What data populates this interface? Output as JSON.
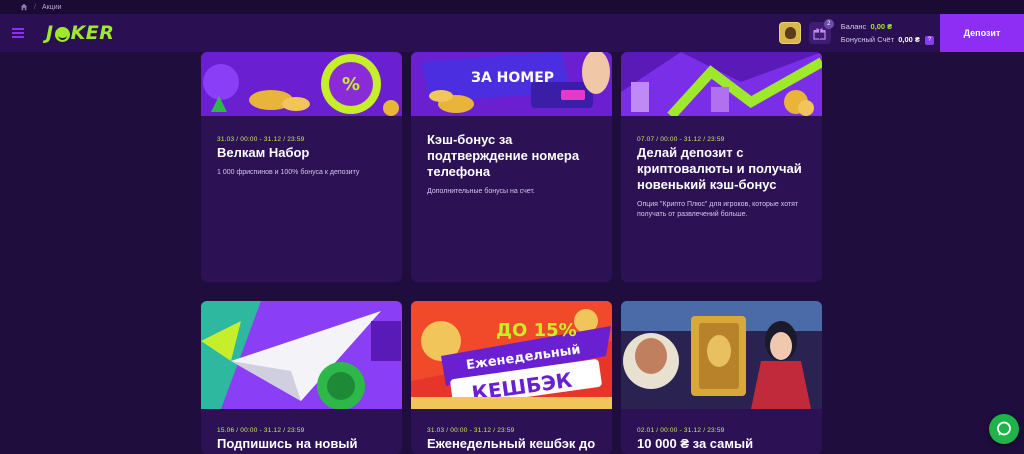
{
  "breadcrumb": {
    "current": "Акции"
  },
  "header": {
    "logo_left": "J",
    "logo_right": "KER",
    "gift_count": "2",
    "balance_label": "Баланс",
    "balance_value": "0,00 ₴",
    "bonus_label": "Бонусный Счёт",
    "bonus_value": "0,00 ₴",
    "help_mark": "?",
    "deposit_label": "Депозит"
  },
  "promos": [
    {
      "date": "31.03 / 00:00 - 31.12 / 23:59",
      "title": "Велкам Набор",
      "description": "1 000 фриспинов и 100% бонуса к депозиту",
      "image_text": "DEPOSIT % BONUS"
    },
    {
      "date": "",
      "title": "Кэш-бонус за подтверждение номера телефона",
      "description": "Дополнительные бонусы на счет.",
      "image_text": "ЗА НОМЕР"
    },
    {
      "date": "07.07 / 00:00 - 31.12 / 23:59",
      "title": "Делай депозит с криптовалюты и получай новенький кэш-бонус",
      "description": "Опция \"Крипто Плюс\" для игроков, которые хотят получать от развлечений больше.",
      "image_text": ""
    },
    {
      "date": "15.06 / 00:00 - 31.12 / 23:59",
      "title": "Подпишись на новый",
      "description": "",
      "image_text": ""
    },
    {
      "date": "31.03 / 00:00 - 31.12 / 23:59",
      "title": "Еженедельный кешбэк до",
      "description": "",
      "image_text_1": "ДО 15%",
      "image_text_2": "Еженедельный",
      "image_text_3": "КЕШБЭК"
    },
    {
      "date": "02.01 / 00:00 - 31.12 / 23:59",
      "title": "10 000 ₴ за самый",
      "description": "",
      "image_text": ""
    }
  ],
  "colors": {
    "page_bg": "#1f0d3d",
    "header_bg": "#2a1052",
    "card_bg": "#2c1155",
    "accent_green": "#9eea2a",
    "deposit_purple": "#8e2ef5"
  }
}
